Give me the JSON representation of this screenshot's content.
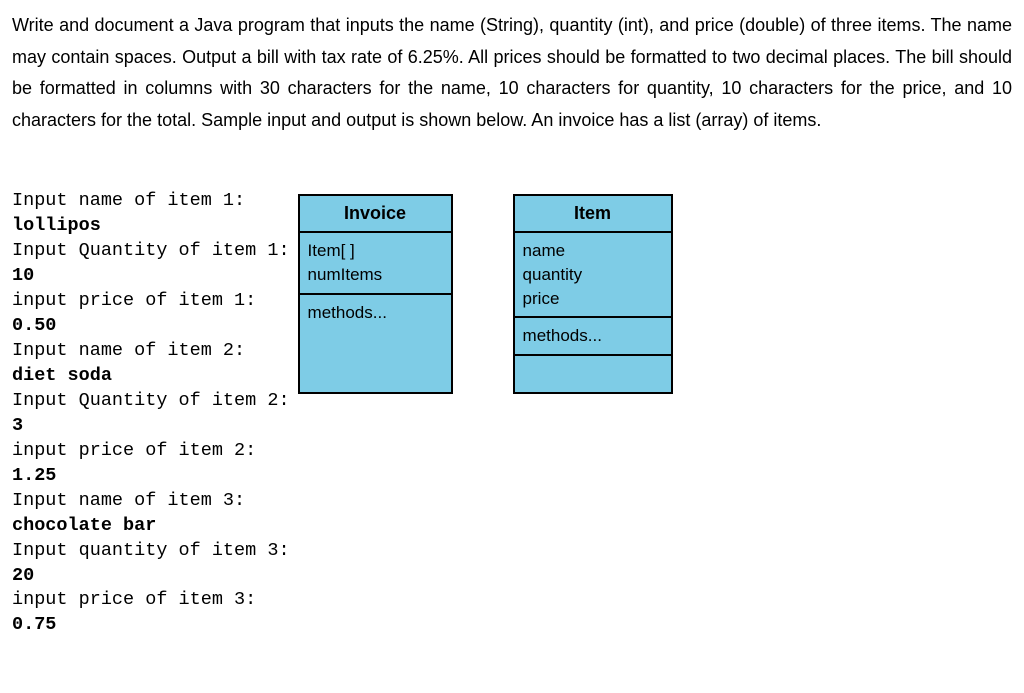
{
  "instructions": "Write and document a Java program that inputs the name (String), quantity (int), and price (double) of three items. The name may contain spaces. Output a bill with tax rate of 6.25%. All prices should be formatted to two decimal places. The bill should be formatted in columns with 30 characters for the name, 10 characters for quantity, 10 characters for the price, and 10 characters for the total. Sample input and output is shown below. An invoice has a list (array) of items.",
  "prompts": {
    "name1": "Input name of item 1:",
    "qty1": "Input Quantity of item 1:",
    "price1": "input price of item 1:",
    "name2": "Input name of item 2:",
    "qty2": "Input Quantity of item 2:",
    "price2": "input price of item 2:",
    "name3": "Input name of item 3:",
    "qty3": "Input quantity of item 3:",
    "price3": "input price of item 3:"
  },
  "inputs": {
    "name1": "lollipos",
    "qty1": "10",
    "price1": "0.50",
    "name2": "diet soda",
    "qty2": "3",
    "price2": "1.25",
    "name3": "chocolate bar",
    "qty3": "20",
    "price3": "0.75"
  },
  "uml": {
    "invoice": {
      "title": "Invoice",
      "attr1": "Item[ ]",
      "attr2": "numItems",
      "methods": "methods..."
    },
    "item": {
      "title": "Item",
      "attr1": "name",
      "attr2": "quantity",
      "attr3": "price",
      "methods": "methods..."
    }
  }
}
